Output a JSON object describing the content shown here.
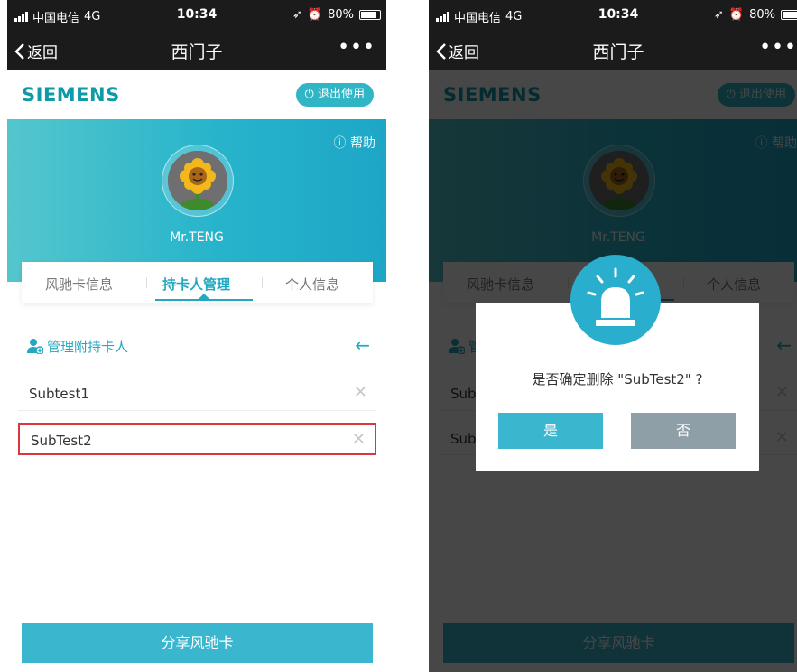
{
  "status": {
    "carrier": "中国电信",
    "network": "4G",
    "time": "10:34",
    "battery": "80%"
  },
  "nav": {
    "back_label": "返回",
    "title": "西门子",
    "more": "•••"
  },
  "brand": {
    "logo": "SIEMENS",
    "exit_label": "退出使用",
    "exit_icon": "power-icon"
  },
  "profile": {
    "help_label": "帮助",
    "help_icon": "question-circle-icon",
    "username": "Mr.TENG"
  },
  "tabs": [
    {
      "label": "风驰卡信息"
    },
    {
      "label": "持卡人管理",
      "active": true
    },
    {
      "label": "个人信息"
    }
  ],
  "section": {
    "title": "管理附持卡人",
    "icon": "user-add-icon",
    "back_icon": "arrow-left-icon"
  },
  "cardholders": [
    {
      "name": "Subtest1"
    },
    {
      "name": "SubTest2",
      "highlighted": true
    }
  ],
  "share_label": "分享风驰卡",
  "dialog": {
    "message": "是否确定删除 \"SubTest2\" ?",
    "confirm_label": "是",
    "cancel_label": "否",
    "icon": "alarm-light-icon"
  },
  "colors": {
    "accent": "#22a9c2",
    "button": "#3bb6cf",
    "highlight_border": "#d9363e",
    "cancel_button": "#8f9fa8",
    "navbar": "#1b1b1b"
  }
}
